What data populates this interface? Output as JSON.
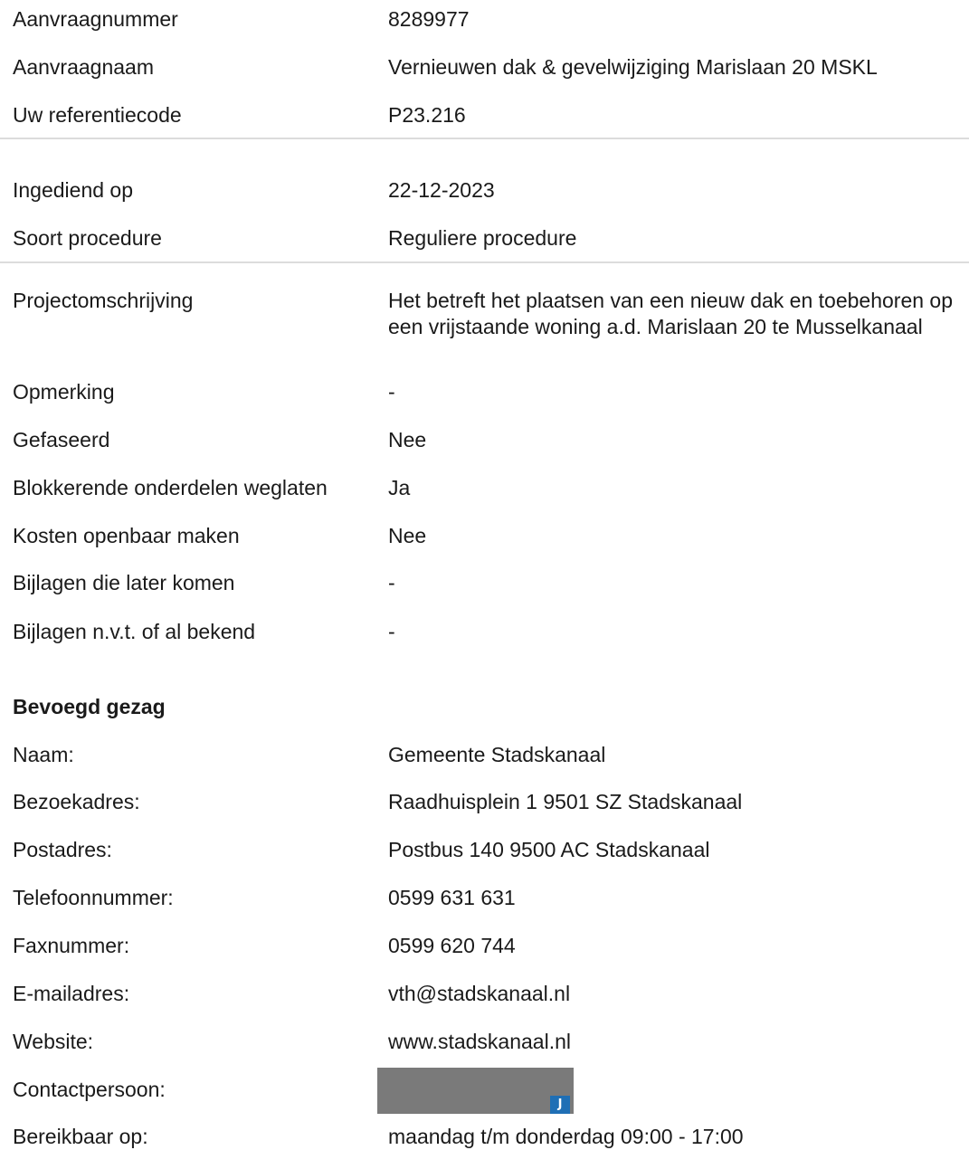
{
  "top": [
    {
      "label": "Aanvraagnummer",
      "value": "8289977"
    },
    {
      "label": "Aanvraagnaam",
      "value": "Vernieuwen dak & gevelwijziging Marislaan 20 MSKL"
    },
    {
      "label": "Uw referentiecode",
      "value": "P23.216"
    }
  ],
  "submission": [
    {
      "label": "Ingediend op",
      "value": "22-12-2023"
    },
    {
      "label": "Soort procedure",
      "value": "Reguliere procedure"
    }
  ],
  "details": [
    {
      "label": "Projectomschrijving",
      "value": "Het betreft het plaatsen van een nieuw dak en toebehoren op een vrijstaande woning a.d. Marislaan 20 te Musselkanaal"
    },
    {
      "label": "Opmerking",
      "value": "-"
    },
    {
      "label": "Gefaseerd",
      "value": "Nee"
    },
    {
      "label": "Blokkerende onderdelen weglaten",
      "value": "Ja"
    },
    {
      "label": "Kosten openbaar maken",
      "value": "Nee"
    },
    {
      "label": "Bijlagen die later komen",
      "value": "-"
    },
    {
      "label": "Bijlagen n.v.t. of al bekend",
      "value": "-"
    }
  ],
  "authority": {
    "heading": "Bevoegd gezag",
    "rows": [
      {
        "label": "Naam:",
        "value": "Gemeente Stadskanaal"
      },
      {
        "label": "Bezoekadres:",
        "value": "Raadhuisplein 1 9501 SZ Stadskanaal"
      },
      {
        "label": "Postadres:",
        "value": "Postbus 140 9500 AC Stadskanaal"
      },
      {
        "label": "Telefoonnummer:",
        "value": "0599 631 631"
      },
      {
        "label": "Faxnummer:",
        "value": "0599 620 744"
      },
      {
        "label": "E-mailadres:",
        "value": "vth@stadskanaal.nl"
      },
      {
        "label": "Website:",
        "value": "www.stadskanaal.nl"
      },
      {
        "label": "Contactpersoon:",
        "value": ""
      },
      {
        "label": "Bereikbaar op:",
        "value": "maandag t/m donderdag 09:00 - 17:00"
      }
    ],
    "redaction_badge": "J"
  }
}
